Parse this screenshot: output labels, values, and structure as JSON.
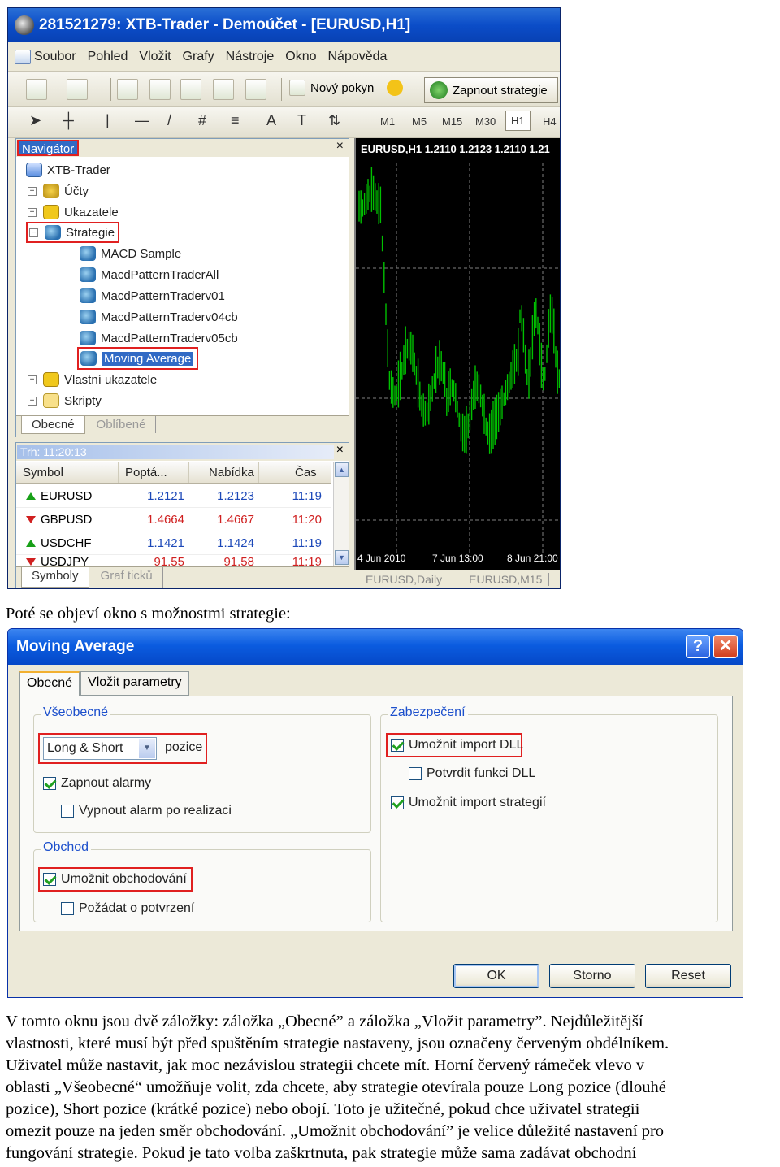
{
  "mt4": {
    "title": "281521279: XTB-Trader - Demoúčet - [EURUSD,H1]",
    "menu": [
      "Soubor",
      "Pohled",
      "Vložit",
      "Grafy",
      "Nástroje",
      "Okno",
      "Nápověda"
    ],
    "toolbar": {
      "new_order": "Nový pokyn",
      "enable_strategies": "Zapnout strategie"
    },
    "timeframes": [
      "M1",
      "M5",
      "M15",
      "M30",
      "H1",
      "H4"
    ],
    "navigator": {
      "title": "Navigátor",
      "root": "XTB-Trader",
      "items": [
        "Účty",
        "Ukazatele",
        "Strategie"
      ],
      "strategies": [
        "MACD Sample",
        "MacdPatternTraderAll",
        "MacdPatternTraderv01",
        "MacdPatternTraderv04cb",
        "MacdPatternTraderv05cb",
        "Moving Average"
      ],
      "items2": [
        "Vlastní ukazatele",
        "Skripty"
      ],
      "tabs": [
        "Obecné",
        "Oblíbené"
      ]
    },
    "market_watch": {
      "title": "Trh: 11:20:13",
      "columns": [
        "Symbol",
        "Poptá...",
        "Nabídka",
        "Čas"
      ],
      "rows": [
        {
          "symbol": "EURUSD",
          "bid": "1.2121",
          "ask": "1.2123",
          "time": "11:19",
          "dir": "up"
        },
        {
          "symbol": "GBPUSD",
          "bid": "1.4664",
          "ask": "1.4667",
          "time": "11:20",
          "dir": "down"
        },
        {
          "symbol": "USDCHF",
          "bid": "1.1421",
          "ask": "1.1424",
          "time": "11:19",
          "dir": "up"
        },
        {
          "symbol": "USDJPY",
          "bid": "91.55",
          "ask": "91.58",
          "time": "11:19",
          "dir": "down"
        }
      ],
      "tabs": [
        "Symboly",
        "Graf ticků"
      ]
    },
    "chart": {
      "header": "EURUSD,H1  1.2110 1.2123 1.2110 1.21",
      "time_labels": [
        "4 Jun 2010",
        "7 Jun 13:00",
        "8 Jun 21:00"
      ],
      "tabs": [
        "EURUSD,Daily",
        "EURUSD,M15"
      ],
      "colors": {
        "bg": "#000000",
        "candles": "#00c000",
        "grid": "#808080"
      }
    }
  },
  "caption1": "Poté se objeví okno s možnostmi strategie:",
  "dialog": {
    "title": "Moving Average",
    "help": "?",
    "close": "✕",
    "tabs": [
      "Obecné",
      "Vložit parametry"
    ],
    "general": {
      "title": "Všeobecné",
      "position_select": "Long & Short",
      "position_label": "pozice",
      "alerts": {
        "label": "Zapnout alarmy",
        "checked": true
      },
      "disable_alert": {
        "label": "Vypnout alarm po realizaci",
        "checked": false
      }
    },
    "trade": {
      "title": "Obchod",
      "enable": {
        "label": "Umožnit obchodování",
        "checked": true
      },
      "confirm": {
        "label": "Požádat o potvrzení",
        "checked": false
      }
    },
    "security": {
      "title": "Zabezpečení",
      "dll": {
        "label": "Umožnit import DLL",
        "checked": true
      },
      "confirm_dll": {
        "label": "Potvrdit funkci DLL",
        "checked": false
      },
      "strat_import": {
        "label": "Umožnit import strategií",
        "checked": true
      }
    },
    "buttons": {
      "ok": "OK",
      "cancel": "Storno",
      "reset": "Reset"
    }
  },
  "paragraph": [
    "V tomto oknu jsou dvě záložky: záložka „Obecné” a záložka „Vložit parametry”. Nejdůležitější",
    "vlastnosti, které musí být před spuštěním strategie nastaveny, jsou označeny červeným obdélníkem.",
    "Uživatel může nastavit, jak moc nezávislou strategii chcete mít. Horní červený rámeček vlevo v",
    "oblasti „Všeobecné“ umožňuje volit, zda chcete, aby strategie otevírala pouze Long pozice (dlouhé",
    "pozice), Short pozice (krátké pozice) nebo obojí. Toto je užitečné, pokud chce uživatel strategii",
    "omezit pouze na jeden směr obchodování. „Umožnit obchodování” je velice důležité nastavení pro",
    "fungování strategie. Pokud je tato volba zaškrtnuta, pak strategie může sama zadávat obchodní"
  ]
}
